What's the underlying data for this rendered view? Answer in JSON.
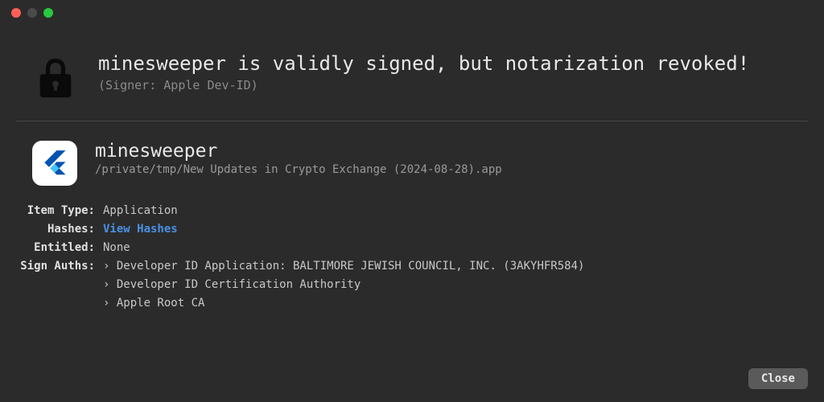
{
  "header": {
    "title": "minesweeper is validly signed, but notarization revoked!",
    "subtitle": "(Signer: Apple Dev-ID)"
  },
  "app": {
    "name": "minesweeper",
    "path": "/private/tmp/New Updates in Crypto Exchange (2024-08-28).app"
  },
  "details": {
    "item_type_label": "Item Type:",
    "item_type_value": "Application",
    "hashes_label": "Hashes:",
    "hashes_link": "View Hashes",
    "entitled_label": "Entitled:",
    "entitled_value": "None",
    "sign_auths_label": "Sign Auths:",
    "sign_auths": [
      "Developer ID Application: BALTIMORE JEWISH COUNCIL, INC. (3AKYHFR584)",
      "Developer ID Certification Authority",
      "Apple Root CA"
    ]
  },
  "footer": {
    "close_label": "Close"
  }
}
